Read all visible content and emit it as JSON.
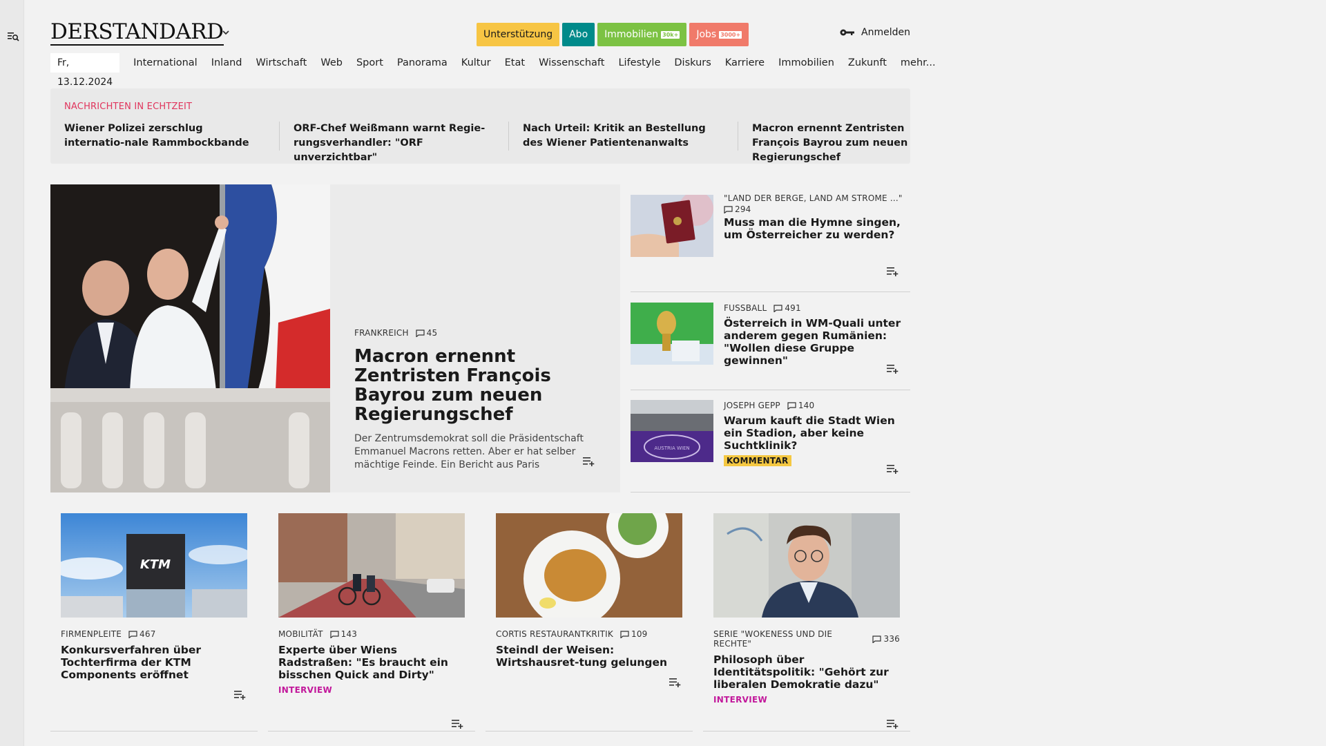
{
  "brand": {
    "logo": "DERSTANDARD"
  },
  "header": {
    "pills": [
      {
        "label": "Unterstützung",
        "color": "#f7c544",
        "text_color": "#1a1a1a",
        "count": ""
      },
      {
        "label": "Abo",
        "color": "#008a8a",
        "text_color": "#ffffff",
        "count": ""
      },
      {
        "label": "Immobilien",
        "color": "#7cc243",
        "text_color": "#ffffff",
        "count": "30k+"
      },
      {
        "label": "Jobs",
        "color": "#f07a6a",
        "text_color": "#ffffff",
        "count": "3000+"
      }
    ],
    "login": "Anmelden"
  },
  "nav": {
    "date": "Fr, 13.12.2024",
    "items": [
      "International",
      "Inland",
      "Wirtschaft",
      "Web",
      "Sport",
      "Panorama",
      "Kultur",
      "Etat",
      "Wissenschaft",
      "Lifestyle",
      "Diskurs",
      "Karriere",
      "Immobilien",
      "Zukunft",
      "mehr..."
    ]
  },
  "ticker": {
    "heading": "NACHRICHTEN IN ECHTZEIT",
    "items": [
      "Wiener Polizei zerschlug internatio-nale Rammbockbande",
      "ORF-Chef Weißmann warnt Regie-rungsverhandler: \"ORF unverzichtbar\"",
      "Nach Urteil: Kritik an Bestellung des Wiener Patientenanwalts",
      "Macron ernennt Zentristen François Bayrou zum neuen Regierungschef"
    ]
  },
  "hero": {
    "kicker": "FRANKREICH",
    "comments": "45",
    "title": "Macron ernennt Zentristen François Bayrou zum neuen Regierungschef",
    "lead": "Der Zentrumsdemokrat soll die Präsidentschaft Emmanuel Macrons retten. Aber er hat selber mächtige Feinde. Ein Bericht aus Paris"
  },
  "side": [
    {
      "kicker": "\"LAND DER BERGE, LAND AM STROME ...\"",
      "comments": "294",
      "title": "Muss man die Hymne singen, um Österreicher zu werden?",
      "badge": ""
    },
    {
      "kicker": "FUSSBALL",
      "comments": "491",
      "title": "Österreich in WM-Quali unter anderem gegen Rumänien: \"Wollen diese Gruppe gewinnen\"",
      "badge": ""
    },
    {
      "kicker": "JOSEPH GEPP",
      "comments": "140",
      "title": "Warum kauft die Stadt Wien ein Stadion, aber keine Suchtklinik?",
      "badge": "KOMMENTAR"
    }
  ],
  "grid": [
    {
      "kicker": "FIRMENPLEITE",
      "comments": "467",
      "title": "Konkursverfahren über Tochterfirma der KTM Components eröffnet",
      "tag": ""
    },
    {
      "kicker": "MOBILITÄT",
      "comments": "143",
      "title": "Experte über Wiens Radstraßen: \"Es braucht ein bisschen Quick and Dirty\"",
      "tag": "INTERVIEW"
    },
    {
      "kicker": "CORTIS RESTAURANTKRITIK",
      "comments": "109",
      "title": "Steindl der Weisen: Wirtshausret-tung gelungen",
      "tag": ""
    },
    {
      "kicker": "SERIE \"WOKENESS UND DIE RECHTE\"",
      "comments": "336",
      "title": "Philosoph über Identitätspolitik: \"Gehört zur liberalen Demokratie dazu\"",
      "tag": "INTERVIEW"
    }
  ],
  "images": {
    "ktm_sign": "KTM",
    "stadium_text": "AUSTRIA WIEN"
  }
}
